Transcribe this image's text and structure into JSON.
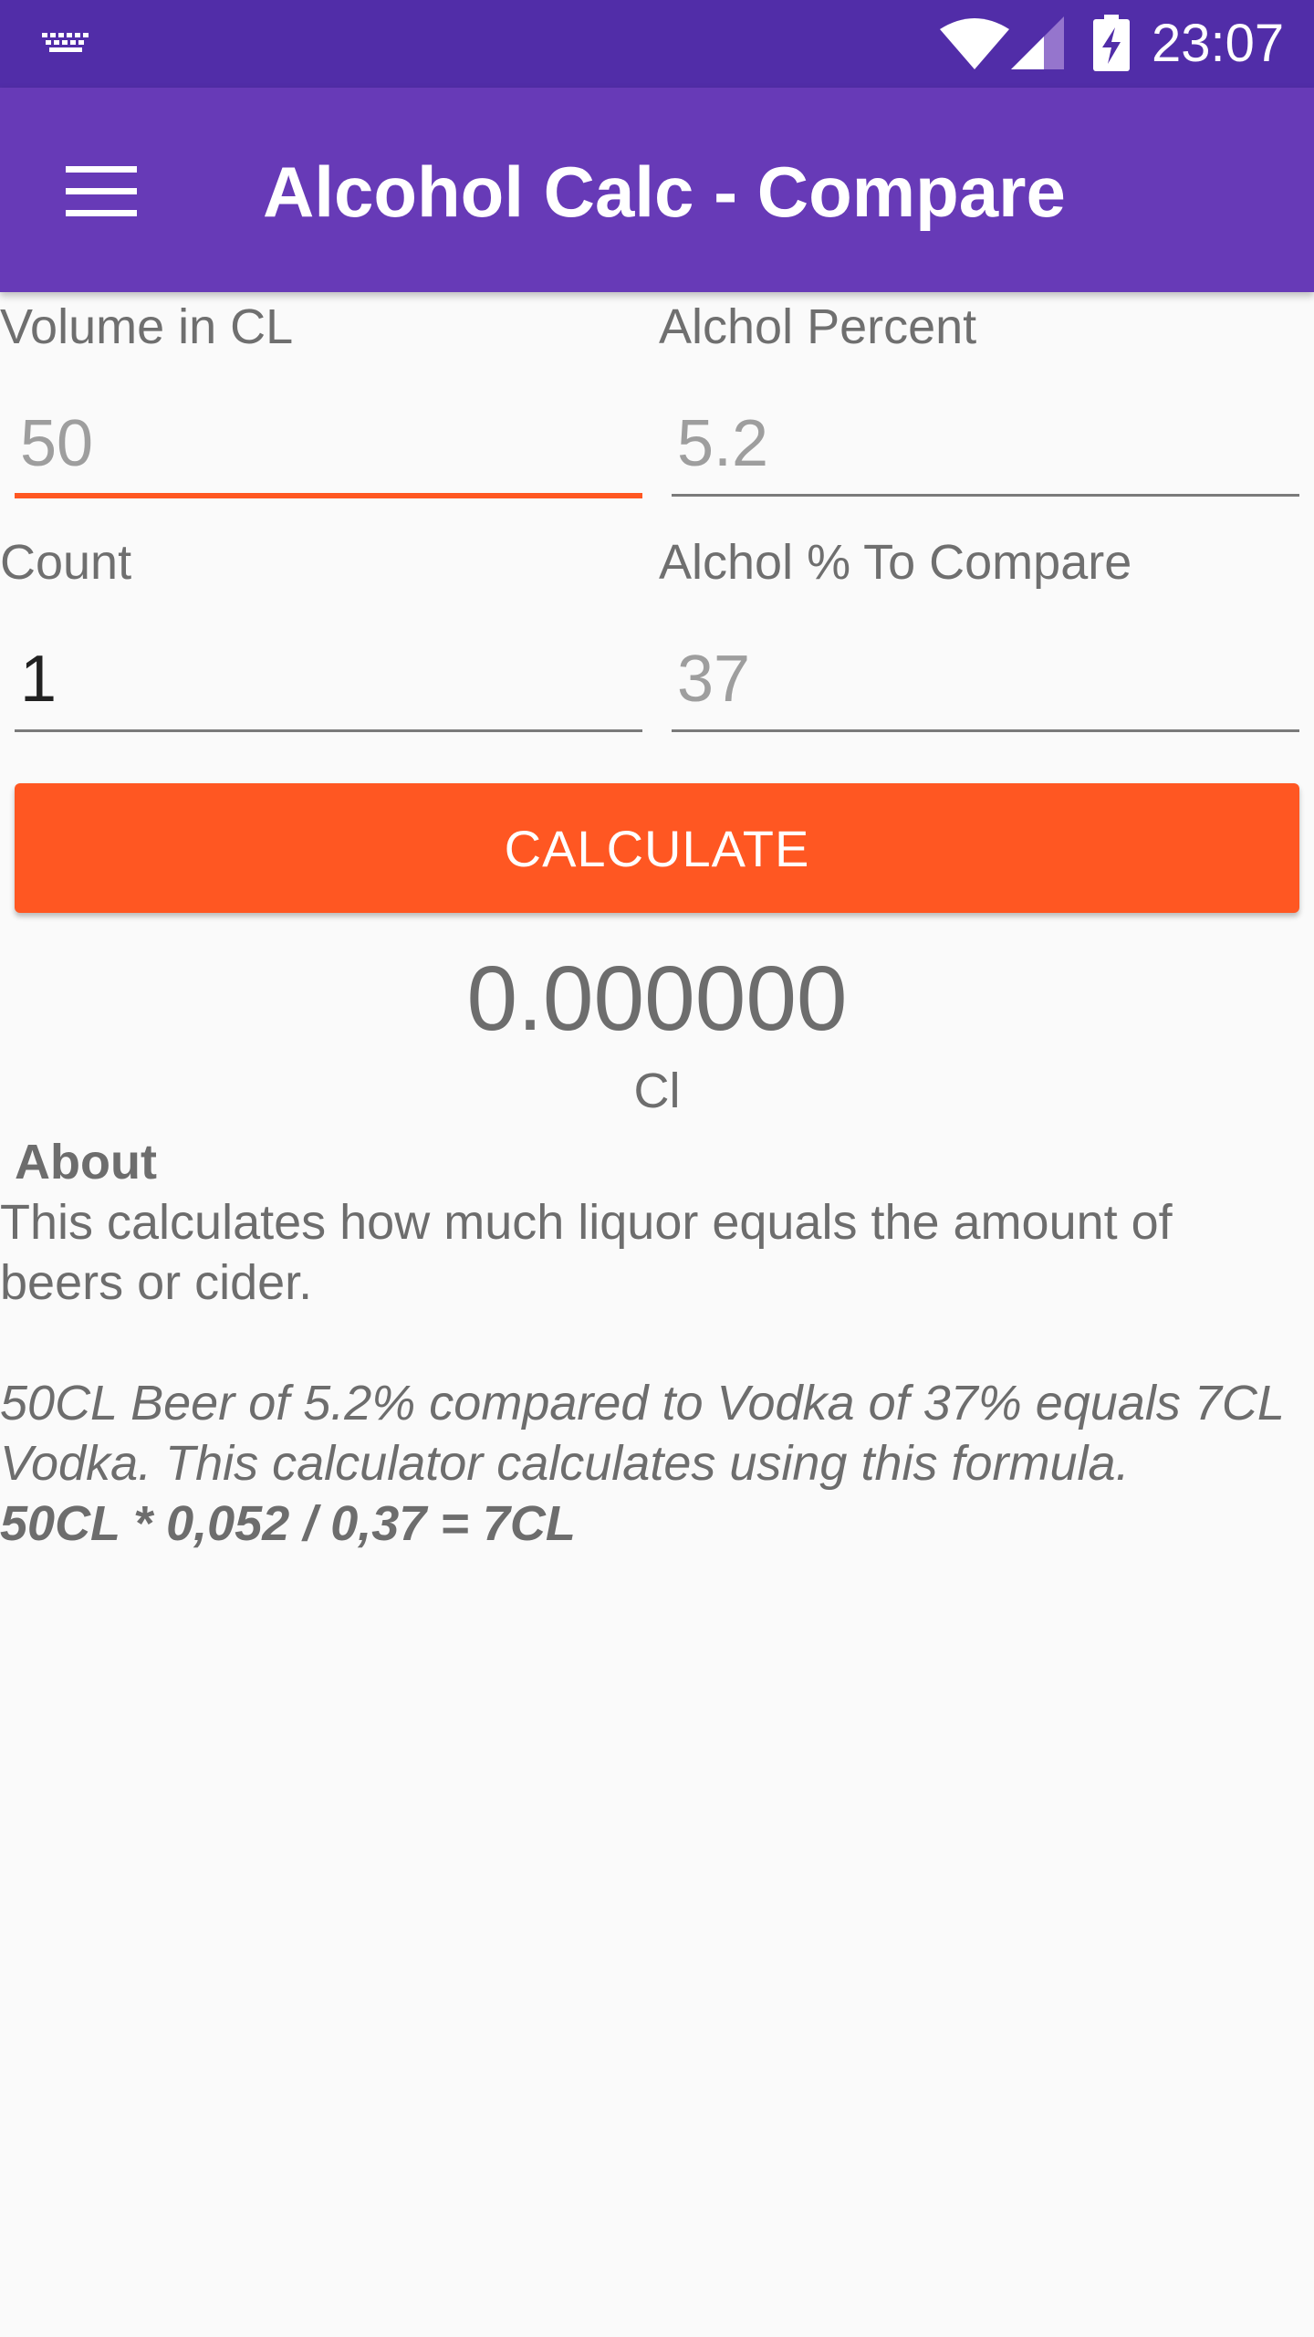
{
  "status_bar": {
    "time": "23:07",
    "icons": [
      "keyboard-icon",
      "wifi-icon",
      "signal-icon",
      "battery-charging-icon"
    ]
  },
  "app_bar": {
    "title": "Alcohol Calc - Compare",
    "menu_icon": "hamburger-menu-icon"
  },
  "form": {
    "volume": {
      "label": "Volume in CL",
      "placeholder": "50",
      "value": ""
    },
    "percent": {
      "label": "Alchol Percent",
      "placeholder": "5.2",
      "value": ""
    },
    "count": {
      "label": "Count",
      "placeholder": "",
      "value": "1"
    },
    "compare": {
      "label": "Alchol % To Compare",
      "placeholder": "37",
      "value": ""
    }
  },
  "calculate_label": "CALCULATE",
  "result": {
    "value": "0.000000",
    "unit": "Cl"
  },
  "about": {
    "heading": "About",
    "description": " This calculates how much liquor equals the amount of beers or cider.",
    "example": " 50CL Beer of 5.2% compared to Vodka of 37% equals 7CL Vodka. This calculator calculates using this formula.",
    "formula": " 50CL * 0,052 / 0,37 = 7CL"
  },
  "colors": {
    "status_bar": "#512da8",
    "app_bar": "#673ab7",
    "accent": "#ff5722",
    "background": "#fafafa"
  }
}
